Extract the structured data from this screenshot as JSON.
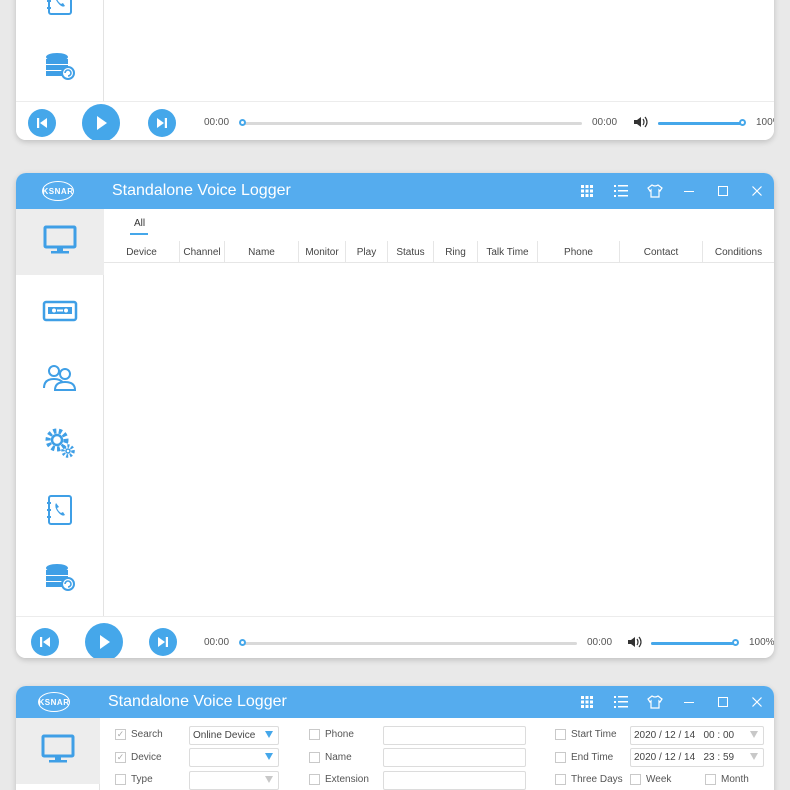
{
  "colors": {
    "accent": "#55acee",
    "button": "#45a7ea",
    "icon": "#3f9fe6"
  },
  "app": {
    "title": "Standalone Voice Logger",
    "logo": "KSNAR"
  },
  "titlebar_icons": [
    "grid-icon",
    "list-icon",
    "shirt-icon",
    "minimize-icon",
    "maximize-icon",
    "close-icon"
  ],
  "sidebar": [
    "monitor-icon",
    "recorder-icon",
    "users-icon",
    "gear-icon",
    "phonebook-icon",
    "database-icon"
  ],
  "player": {
    "top": {
      "time_start": "00:00",
      "time_end": "00:00",
      "volume_label": "100%",
      "progress": 0.0,
      "volume": 1.0
    },
    "main": {
      "time_start": "00:00",
      "time_end": "00:00",
      "volume_label": "100%",
      "progress": 0.0,
      "volume": 1.0
    }
  },
  "monitor_view": {
    "tabs": [
      "All"
    ],
    "columns": [
      "Device",
      "Channel",
      "Name",
      "Monitor",
      "Play",
      "Status",
      "Ring",
      "Talk Time",
      "Phone",
      "Contact",
      "Conditions"
    ]
  },
  "search_form": {
    "search_label": "Search",
    "device_label": "Device",
    "type_label": "Type",
    "device_select_value": "Online Device",
    "device_select2_value": "",
    "type_select_value": "",
    "phone_label": "Phone",
    "name_label": "Name",
    "extension_label": "Extension",
    "phone_value": "",
    "name_value": "",
    "extension_value": "",
    "start_time_label": "Start Time",
    "end_time_label": "End Time",
    "start_time_value": "2020 / 12 / 14   00 : 00",
    "end_time_value": "2020 / 12 / 14   23 : 59",
    "three_days_label": "Three Days",
    "week_label": "Week",
    "month_label": "Month"
  }
}
